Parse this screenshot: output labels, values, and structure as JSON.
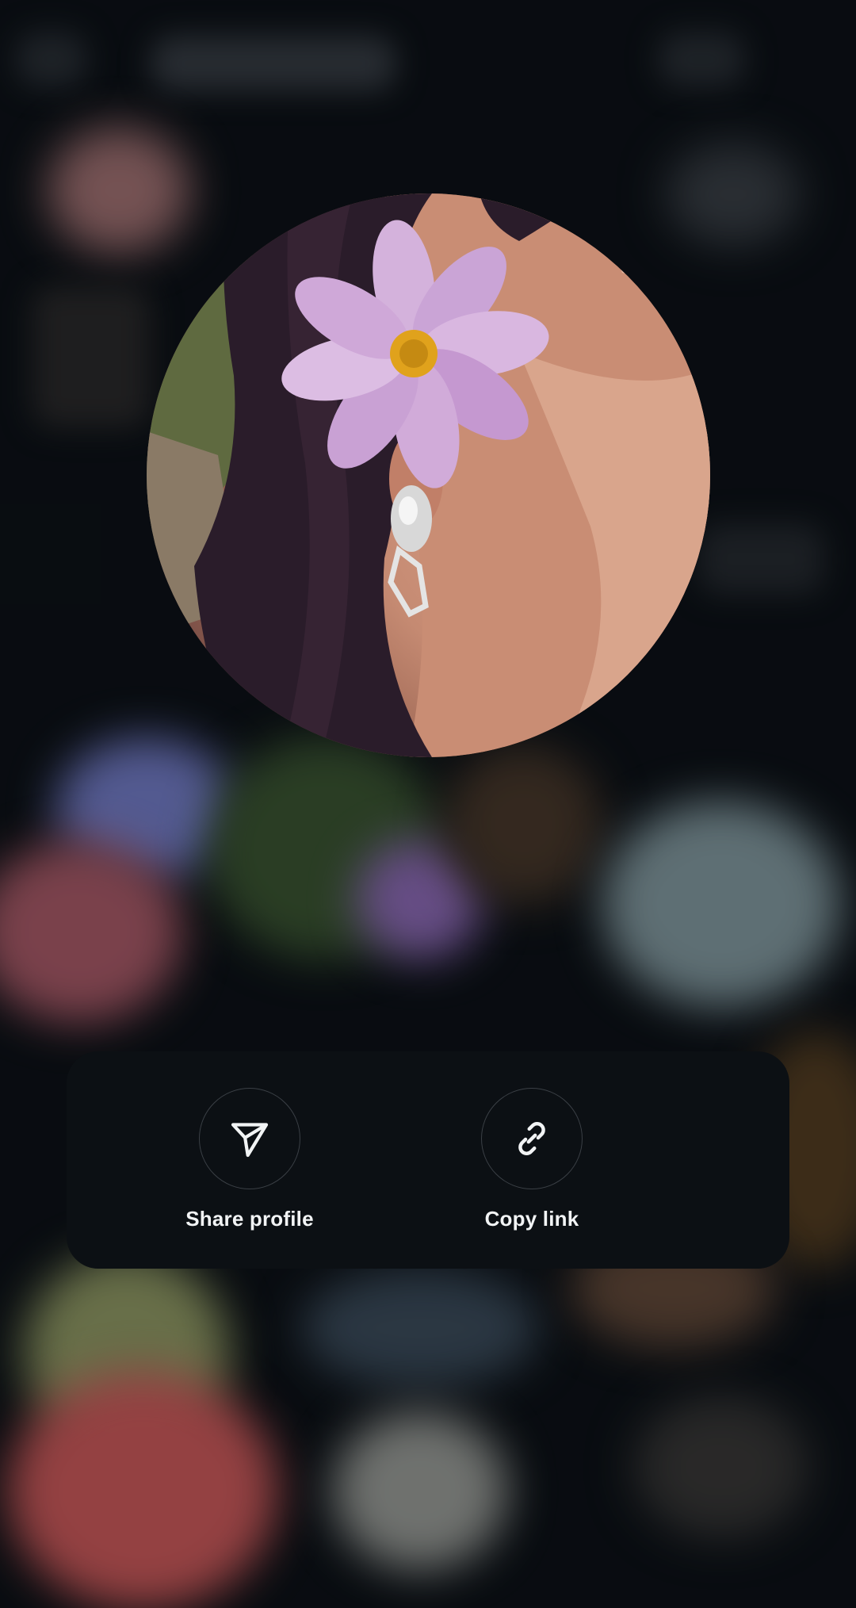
{
  "sheet": {
    "actions": [
      {
        "label": "Share profile",
        "icon": "paper-plane-icon"
      },
      {
        "label": "Copy link",
        "icon": "link-icon"
      }
    ]
  },
  "avatar": {
    "description_icon": "profile-photo"
  }
}
